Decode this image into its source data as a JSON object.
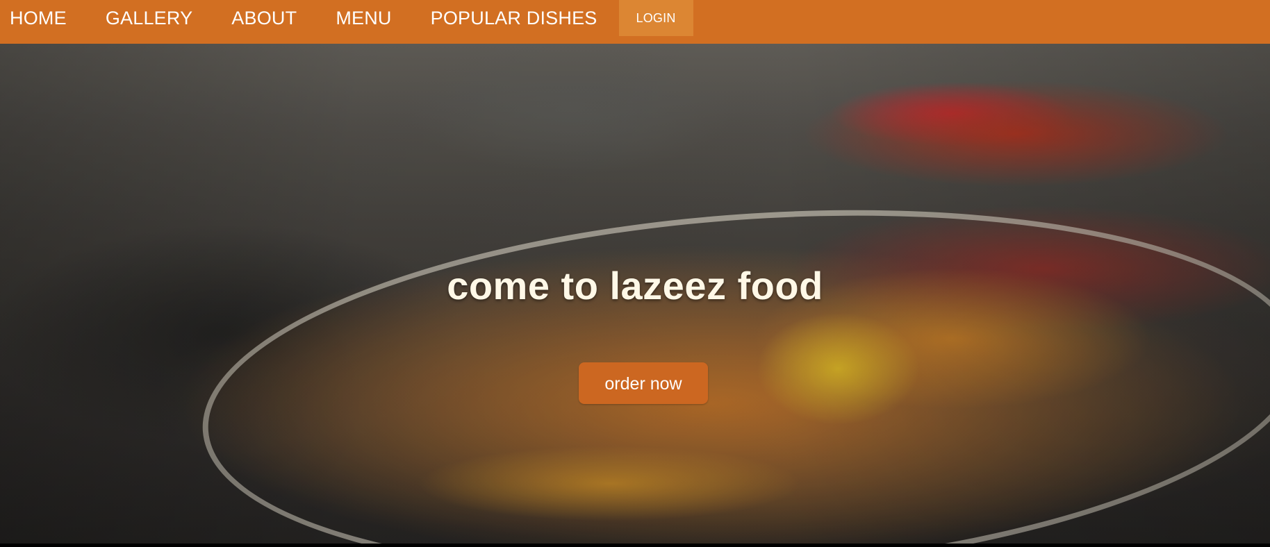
{
  "navbar": {
    "items": [
      {
        "label": "HOME"
      },
      {
        "label": "GALLERY"
      },
      {
        "label": "ABOUT"
      },
      {
        "label": "MENU"
      },
      {
        "label": "POPULAR DISHES"
      },
      {
        "label": "LOGIN"
      }
    ]
  },
  "hero": {
    "title": "come to lazeez food",
    "button_label": "order now"
  },
  "colors": {
    "navbar_background": "#d26f22",
    "login_background": "#dc8633",
    "button_background": "#cc6721",
    "hero_text": "#fff8e7"
  }
}
